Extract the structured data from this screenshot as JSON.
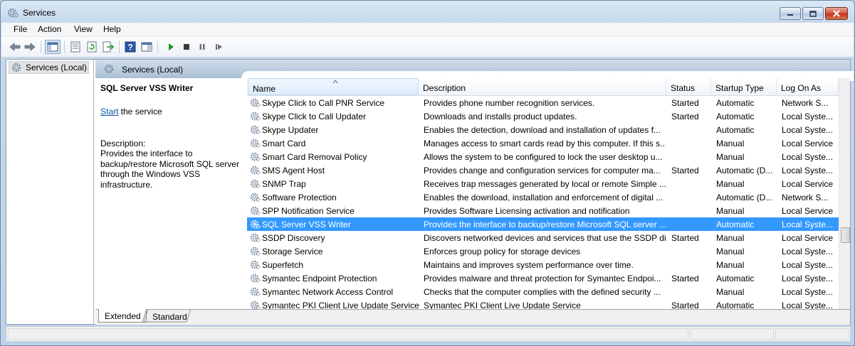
{
  "window": {
    "title": "Services",
    "min_icon": "minimize-icon",
    "max_icon": "maximize-icon",
    "close_icon": "close-icon"
  },
  "menu": [
    "File",
    "Action",
    "View",
    "Help"
  ],
  "toolbar": [
    "back-icon",
    "forward-icon",
    "show-hide-console-tree-icon",
    "properties-icon",
    "refresh-icon",
    "export-list-icon",
    "help-icon",
    "action-pane-icon",
    "start-service-icon",
    "stop-service-icon",
    "pause-service-icon",
    "restart-service-icon"
  ],
  "tree": {
    "label": "Services (Local)"
  },
  "pane": {
    "header": "Services (Local)"
  },
  "details": {
    "title": "SQL Server VSS Writer",
    "start_link": "Start",
    "start_suffix": " the service",
    "description_label": "Description:",
    "description": "Provides the interface to backup/restore Microsoft SQL server through the Windows VSS infrastructure."
  },
  "columns": {
    "name": "Name",
    "description": "Description",
    "status": "Status",
    "startup": "Startup Type",
    "logon": "Log On As"
  },
  "rows": [
    {
      "name": "Skype Click to Call PNR Service",
      "description": "Provides phone number recognition services.",
      "status": "Started",
      "startup": "Automatic",
      "logon": "Network S..."
    },
    {
      "name": "Skype Click to Call Updater",
      "description": "Downloads and installs product updates.",
      "status": "Started",
      "startup": "Automatic",
      "logon": "Local Syste..."
    },
    {
      "name": "Skype Updater",
      "description": "Enables the detection, download and installation of updates f...",
      "status": "",
      "startup": "Automatic",
      "logon": "Local Syste..."
    },
    {
      "name": "Smart Card",
      "description": "Manages access to smart cards read by this computer. If this s...",
      "status": "",
      "startup": "Manual",
      "logon": "Local Service"
    },
    {
      "name": "Smart Card Removal Policy",
      "description": "Allows the system to be configured to lock the user desktop u...",
      "status": "",
      "startup": "Manual",
      "logon": "Local Syste..."
    },
    {
      "name": "SMS Agent Host",
      "description": "Provides change and configuration services for computer ma...",
      "status": "Started",
      "startup": "Automatic (D...",
      "logon": "Local Syste..."
    },
    {
      "name": "SNMP Trap",
      "description": "Receives trap messages generated by local or remote Simple ...",
      "status": "",
      "startup": "Manual",
      "logon": "Local Service"
    },
    {
      "name": "Software Protection",
      "description": "Enables the download, installation and enforcement of digital ...",
      "status": "",
      "startup": "Automatic (D...",
      "logon": "Network S..."
    },
    {
      "name": "SPP Notification Service",
      "description": "Provides Software Licensing activation and notification",
      "status": "",
      "startup": "Manual",
      "logon": "Local Service"
    },
    {
      "name": "SQL Server VSS Writer",
      "description": "Provides the interface to backup/restore Microsoft SQL server ...",
      "status": "",
      "startup": "Automatic",
      "logon": "Local Syste...",
      "selected": true
    },
    {
      "name": "SSDP Discovery",
      "description": "Discovers networked devices and services that use the SSDP di...",
      "status": "Started",
      "startup": "Manual",
      "logon": "Local Service"
    },
    {
      "name": "Storage Service",
      "description": "Enforces group policy for storage devices",
      "status": "",
      "startup": "Manual",
      "logon": "Local Syste..."
    },
    {
      "name": "Superfetch",
      "description": "Maintains and improves system performance over time.",
      "status": "",
      "startup": "Manual",
      "logon": "Local Syste..."
    },
    {
      "name": "Symantec Endpoint Protection",
      "description": "Provides malware and threat protection for Symantec Endpoi...",
      "status": "Started",
      "startup": "Automatic",
      "logon": "Local Syste..."
    },
    {
      "name": "Symantec Network Access Control",
      "description": "Checks that the computer complies with the defined security ...",
      "status": "",
      "startup": "Manual",
      "logon": "Local Syste..."
    },
    {
      "name": "Symantec PKI Client Live Update Service",
      "description": "Symantec PKI Client Live Update Service",
      "status": "Started",
      "startup": "Automatic",
      "logon": "Local Syste..."
    }
  ],
  "tabs": [
    "Extended",
    "Standard"
  ],
  "colors": {
    "selection": "#3399ff",
    "link": "#0b54ad",
    "play": "#1a9a1a"
  }
}
